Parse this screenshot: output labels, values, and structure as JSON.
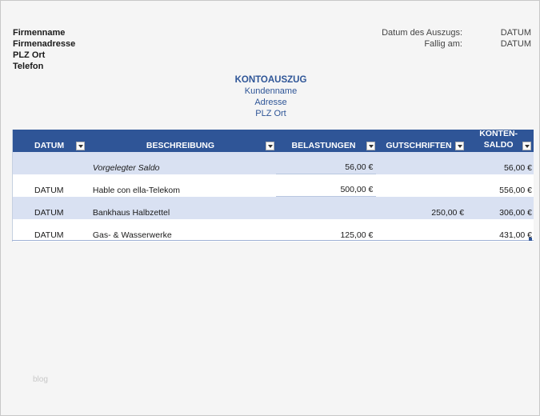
{
  "company": {
    "name": "Firmenname",
    "address": "Firmenadresse",
    "city": "PLZ Ort",
    "phone": "Telefon"
  },
  "meta": {
    "statement_date_label": "Datum des Auszugs:",
    "statement_date_value": "DATUM",
    "due_label": "Fallig am:",
    "due_value": "DATUM"
  },
  "header": {
    "title": "KONTOAUSZUG",
    "customer": "Kundenname",
    "address": "Adresse",
    "city": "PLZ Ort"
  },
  "table": {
    "columns": {
      "date": "DATUM",
      "description": "BESCHREIBUNG",
      "debits": "BELASTUNGEN",
      "credits": "GUTSCHRIFTEN",
      "balance_line1": "KONTEN-",
      "balance_line2": "SALDO"
    },
    "rows": [
      {
        "date": "",
        "description": "Vorgelegter Saldo",
        "debits": "56,00 €",
        "credits": "",
        "balance": "56,00 €"
      },
      {
        "date": "DATUM",
        "description": "Hable con ella-Telekom",
        "debits": "500,00 €",
        "credits": "",
        "balance": "556,00 €"
      },
      {
        "date": "DATUM",
        "description": "Bankhaus Halbzettel",
        "debits": "",
        "credits": "250,00 €",
        "balance": "306,00 €"
      },
      {
        "date": "DATUM",
        "description": "Gas- & Wasserwerke",
        "debits": "125,00 €",
        "credits": "",
        "balance": "431,00 €"
      }
    ]
  },
  "watermark": "blog"
}
